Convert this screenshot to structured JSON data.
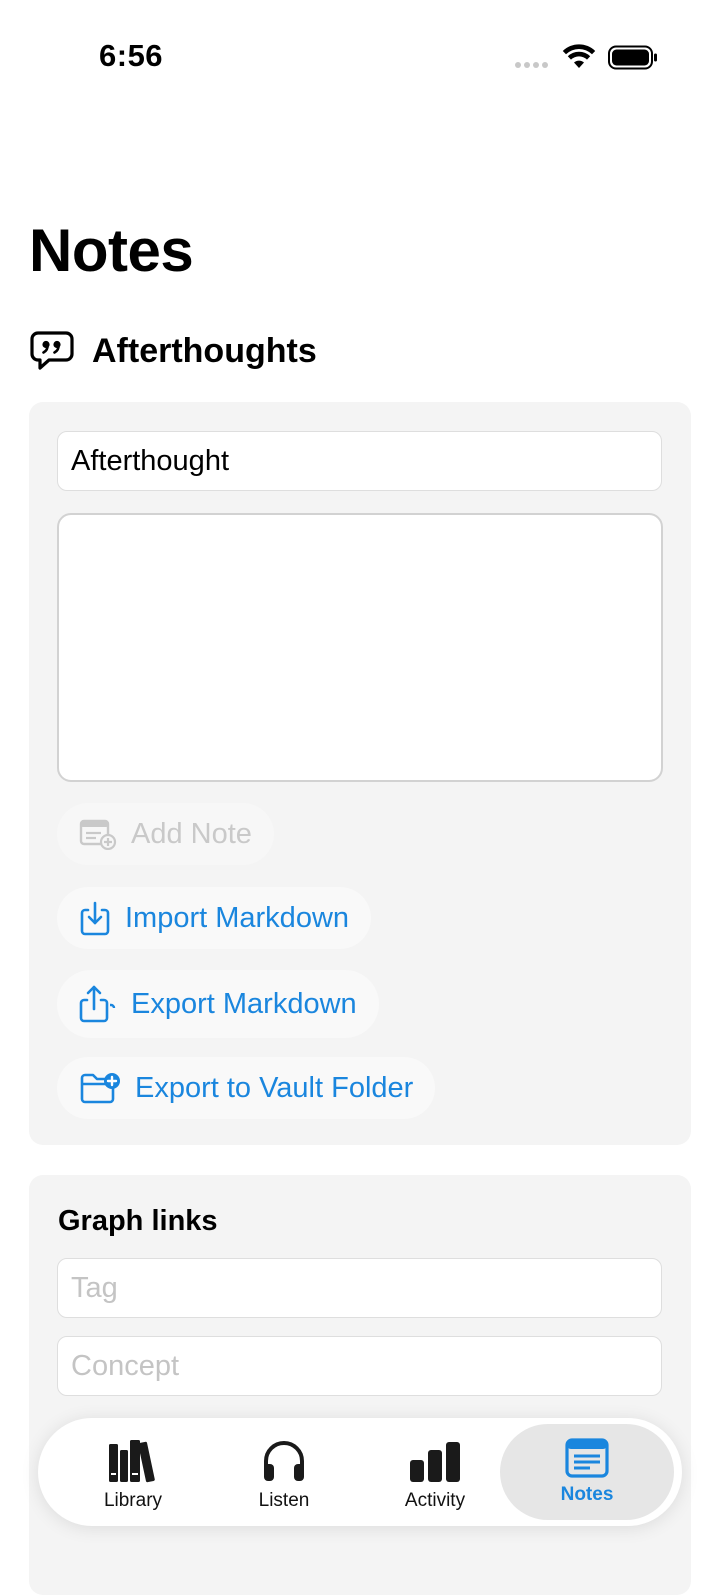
{
  "status_bar": {
    "time": "6:56"
  },
  "page": {
    "title": "Notes"
  },
  "section": {
    "title": "Afterthoughts",
    "icon": "quote-bubble-icon"
  },
  "notes_form": {
    "title_value": "Afterthought",
    "body_value": "",
    "actions": {
      "add_note": "Add Note",
      "import_markdown": "Import Markdown",
      "export_markdown": "Export Markdown",
      "export_vault": "Export to Vault Folder"
    }
  },
  "graph_links": {
    "title": "Graph links",
    "tag_placeholder": "Tag",
    "concept_placeholder": "Concept"
  },
  "tabs": [
    {
      "label": "Library",
      "icon": "books-icon"
    },
    {
      "label": "Listen",
      "icon": "headphones-icon"
    },
    {
      "label": "Activity",
      "icon": "bar-chart-icon"
    },
    {
      "label": "Notes",
      "icon": "notes-icon"
    }
  ],
  "colors": {
    "accent": "#1a86de",
    "card_bg": "#f4f4f4"
  }
}
